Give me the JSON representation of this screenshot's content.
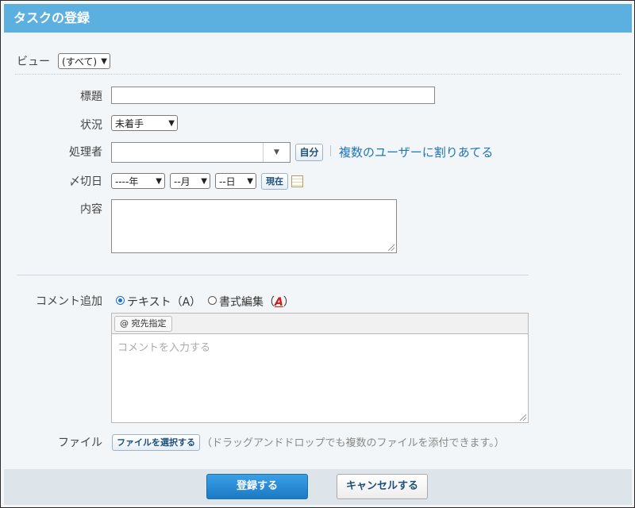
{
  "header": {
    "title": "タスクの登録"
  },
  "view": {
    "label": "ビュー",
    "selected": "(すべて)"
  },
  "form": {
    "title_label": "標題",
    "title_value": "",
    "status_label": "状況",
    "status_selected": "未着手",
    "assignee_label": "処理者",
    "assignee_value": "",
    "self_button": "自分",
    "multi_assign_link": "複数のユーザーに割りあてる",
    "deadline_label": "〆切日",
    "year_selected": "----年",
    "month_selected": "--月",
    "day_selected": "--日",
    "now_button": "現在",
    "content_label": "内容",
    "content_value": ""
  },
  "comment": {
    "label": "コメント追加",
    "mode_text": "テキスト（A）",
    "mode_rich_prefix": "書式編集（",
    "mode_rich_icon": "A",
    "mode_rich_suffix": "）",
    "selected_mode": "text",
    "mention_button": "@ 宛先指定",
    "placeholder": "コメントを入力する"
  },
  "file": {
    "label": "ファイル",
    "choose_button": "ファイルを選択する",
    "note": "（ドラッグアンドドロップでも複数のファイルを添付できます。）"
  },
  "footer": {
    "submit": "登録する",
    "cancel": "キャンセルする"
  },
  "colors": {
    "header_bg": "#5bb0e0",
    "primary": "#1b79c4",
    "link": "#1d74b8"
  }
}
